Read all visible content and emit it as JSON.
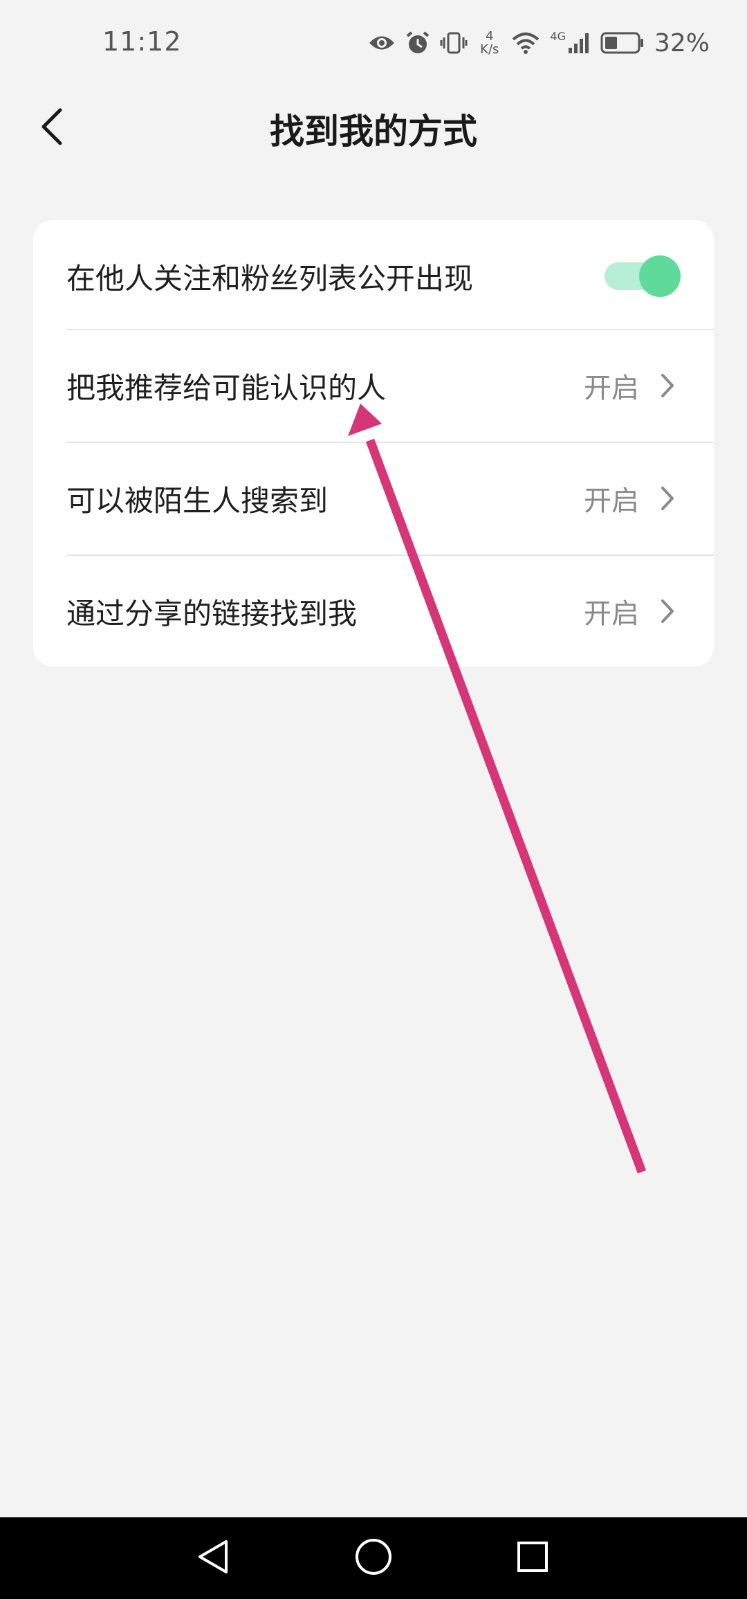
{
  "status_bar": {
    "time": "11:12",
    "net_speed_value": "4",
    "net_speed_unit": "K/s",
    "network_type": "4G",
    "battery_percent": "32%",
    "icons": [
      "eye-icon",
      "alarm-icon",
      "vibrate-icon",
      "wifi-icon",
      "signal-icon",
      "battery-icon"
    ]
  },
  "header": {
    "title": "找到我的方式",
    "back_icon": "chevron-left-icon"
  },
  "settings": {
    "items": [
      {
        "label": "在他人关注和粉丝列表公开出现",
        "control": "toggle",
        "toggle_on": true
      },
      {
        "label": "把我推荐给可能认识的人",
        "value": "开启",
        "control": "chevron"
      },
      {
        "label": "可以被陌生人搜索到",
        "value": "开启",
        "control": "chevron"
      },
      {
        "label": "通过分享的链接找到我",
        "value": "开启",
        "control": "chevron"
      }
    ]
  },
  "colors": {
    "background": "#f3f3f3",
    "card": "#ffffff",
    "toggle_track": "#b9eed6",
    "toggle_knob": "#5fda9b",
    "annotation_arrow": "#d63577",
    "nav_bar": "#000000"
  },
  "nav_bar": {
    "icons": [
      "back-triangle-icon",
      "home-circle-icon",
      "recents-square-icon"
    ]
  }
}
